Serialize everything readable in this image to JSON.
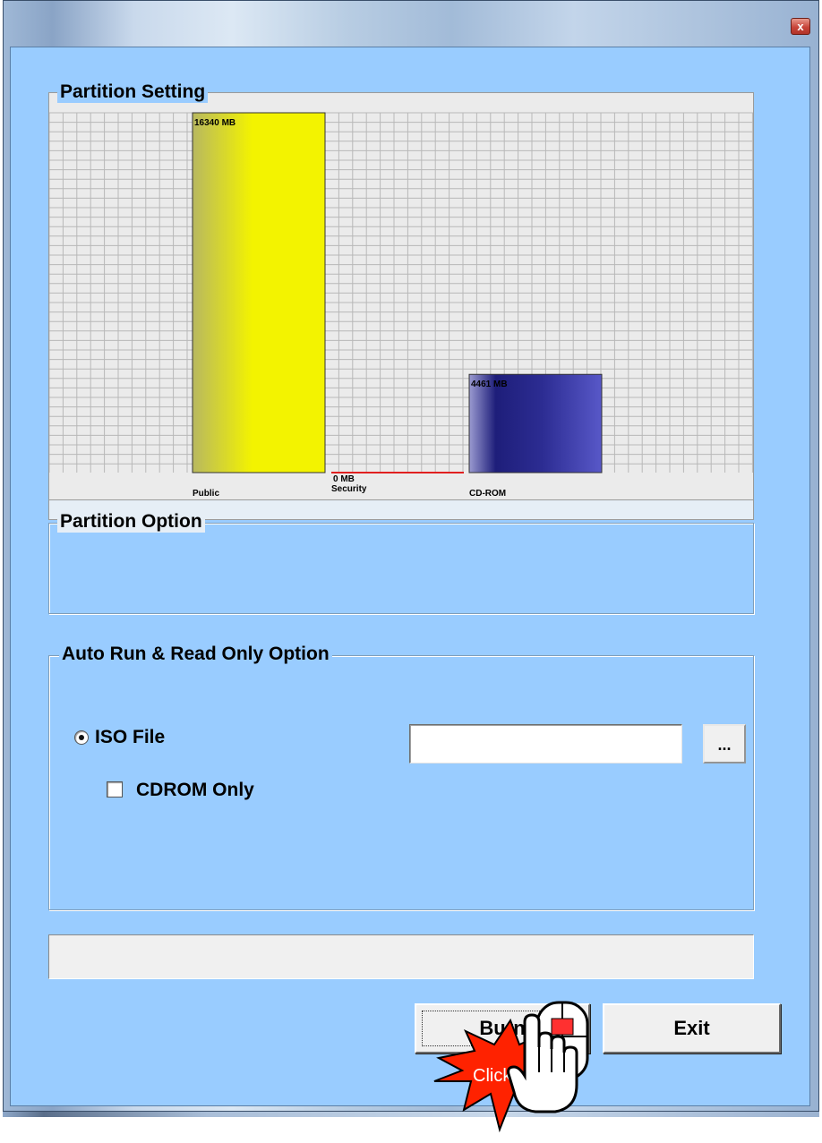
{
  "window": {
    "close_icon": "close-icon",
    "close_glyph": "x"
  },
  "partition_setting": {
    "title": "Partition Setting",
    "chart_data": {
      "type": "bar",
      "categories": [
        "Public",
        "Security",
        "CD-ROM"
      ],
      "values": [
        16340,
        0,
        4461
      ],
      "data_labels": [
        "16340 MB",
        "0 MB",
        "4461 MB"
      ],
      "colors": [
        "#f2f200",
        "#e02020",
        "#3b3ba8"
      ],
      "grid": true,
      "ylim": [
        0,
        16340
      ]
    }
  },
  "partition_option": {
    "title": "Partition Option"
  },
  "auto_run": {
    "title": "Auto Run & Read Only Option",
    "iso_file_label": "ISO File",
    "iso_file_selected": true,
    "iso_path_value": "",
    "browse_label": "...",
    "cdrom_only_label": "CDROM Only",
    "cdrom_only_checked": false
  },
  "status": {
    "text": ""
  },
  "buttons": {
    "burn_label": "Burn",
    "exit_label": "Exit"
  },
  "overlay": {
    "click_text": "Click",
    "cursor_icon": "hand-cursor-icon",
    "mouse_icon": "mouse-icon"
  }
}
